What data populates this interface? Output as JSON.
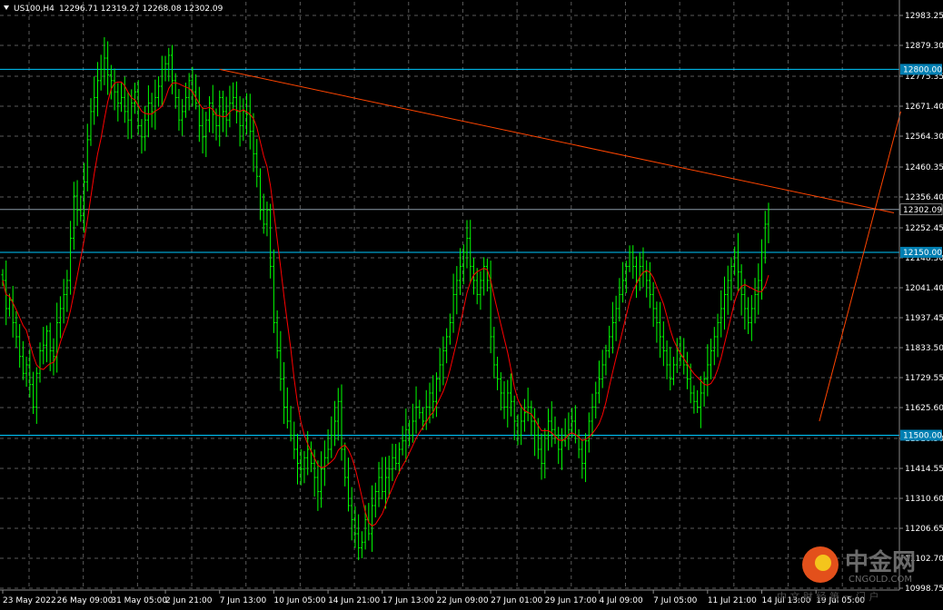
{
  "header": {
    "symbol": "US100,H4",
    "ohlc": "12296.71 12319.27 12268.08 12302.09"
  },
  "watermark": {
    "cn": "中金网",
    "en": "CNGOLD.COM",
    "sub": "中 文 财 经 第 一 门 户"
  },
  "colors": {
    "background": "#000000",
    "bars": "#00ff00",
    "ma": "#ff0000",
    "hlines": "#00c8ff",
    "trendlines": "#ff4500",
    "grid": "#5a5a5a",
    "text": "#ffffff",
    "current_price_line": "#8a9aa8"
  },
  "chart_data": {
    "type": "ohlc",
    "title": "US100,H4",
    "ylim": [
      10950,
      13040
    ],
    "y_ticks": [
      "12983.25",
      "12879.30",
      "12775.35",
      "12671.40",
      "12564.30",
      "12460.35",
      "12356.40",
      "12252.45",
      "12148.50",
      "12041.40",
      "11937.45",
      "11833.50",
      "11729.55",
      "11625.60",
      "11518.50",
      "11414.55",
      "11310.60",
      "11206.65",
      "11102.70",
      "10998.75"
    ],
    "x_labels": [
      "23 May 2022",
      "26 May 09:00",
      "31 May 05:00",
      "2 Jun 21:00",
      "7 Jun 13:00",
      "10 Jun 05:00",
      "14 Jun 21:00",
      "17 Jun 13:00",
      "22 Jun 09:00",
      "27 Jun 01:00",
      "29 Jun 17:00",
      "4 Jul 09:00",
      "7 Jul 05:00",
      "11 Jul 21:00",
      "14 Jul 13:00",
      "19 Jul 05:00"
    ],
    "x_label_bar_index": [
      0,
      16,
      32,
      48,
      64,
      80,
      96,
      112,
      128,
      144,
      160,
      176,
      192,
      208,
      224,
      240
    ],
    "series": [
      {
        "name": "US100,H4",
        "kind": "ohlc",
        "close": [
          12050,
          11950,
          11980,
          11900,
          11850,
          11780,
          11720,
          11750,
          11680,
          11600,
          11720,
          11800,
          11820,
          11870,
          11800,
          11780,
          11900,
          11950,
          12000,
          12050,
          12200,
          12350,
          12300,
          12280,
          12400,
          12550,
          12650,
          12700,
          12760,
          12800,
          12840,
          12780,
          12760,
          12720,
          12680,
          12700,
          12650,
          12620,
          12680,
          12720,
          12600,
          12560,
          12620,
          12680,
          12650,
          12700,
          12740,
          12800,
          12820,
          12850,
          12760,
          12700,
          12620,
          12650,
          12700,
          12760,
          12720,
          12680,
          12600,
          12560,
          12620,
          12680,
          12640,
          12600,
          12700,
          12650,
          12620,
          12680,
          12700,
          12650,
          12600,
          12650,
          12640,
          12580,
          12500,
          12420,
          12300,
          12250,
          12300,
          12100,
          11900,
          11800,
          11700,
          11600,
          11550,
          11500,
          11450,
          11400,
          11380,
          11420,
          11450,
          11400,
          11350,
          11300,
          11380,
          11420,
          11450,
          11500,
          11550,
          11620,
          11450,
          11350,
          11250,
          11200,
          11150,
          11100,
          11120,
          11200,
          11150,
          11250,
          11300,
          11350,
          11300,
          11350,
          11380,
          11420,
          11400,
          11450,
          11480,
          11520,
          11500,
          11550,
          11600,
          11580,
          11550,
          11600,
          11650,
          11620,
          11700,
          11750,
          11800,
          11850,
          11900,
          12000,
          12050,
          12100,
          12150,
          12200,
          12100,
          12050,
          12000,
          12050,
          12100,
          12050,
          11850,
          11750,
          11700,
          11650,
          11600,
          11650,
          11620,
          11550,
          11500,
          11550,
          11580,
          11600,
          11550,
          11500,
          11450,
          11400,
          11500,
          11550,
          11520,
          11500,
          11450,
          11480,
          11500,
          11520,
          11550,
          11500,
          11450,
          11400,
          11480,
          11550,
          11600,
          11650,
          11700,
          11750,
          11800,
          11850,
          11900,
          11950,
          12000,
          12050,
          12100,
          12150,
          12100,
          12050,
          12100,
          12080,
          12050,
          12000,
          11950,
          11900,
          11850,
          11800,
          11750,
          11700,
          11750,
          11800,
          11780,
          11750,
          11700,
          11650,
          11620,
          11600,
          11650,
          11700,
          11750,
          11800,
          11850,
          11900,
          11950,
          12000,
          12050,
          12100,
          12150,
          12080,
          12000,
          11950,
          11900,
          11950,
          12000,
          12050,
          12150,
          12250,
          12302.09
        ]
      },
      {
        "name": "",
        "kind": "moving-average"
      }
    ],
    "horizontal_lines": [
      {
        "price": 12800,
        "label": "12800.00"
      },
      {
        "price": 12150,
        "label": "12150.00"
      },
      {
        "price": 11500,
        "label": "11500.00"
      }
    ],
    "current_price": {
      "price": 12302.09,
      "label": "12302.09"
    },
    "trendlines": [
      {
        "from": {
          "bar": 64,
          "price": 12800
        },
        "to": {
          "bar": 263,
          "price": 12290
        }
      },
      {
        "from": {
          "bar": 241,
          "price": 11550
        },
        "to": {
          "bar": 265,
          "price": 12650
        }
      }
    ],
    "grid": true
  }
}
